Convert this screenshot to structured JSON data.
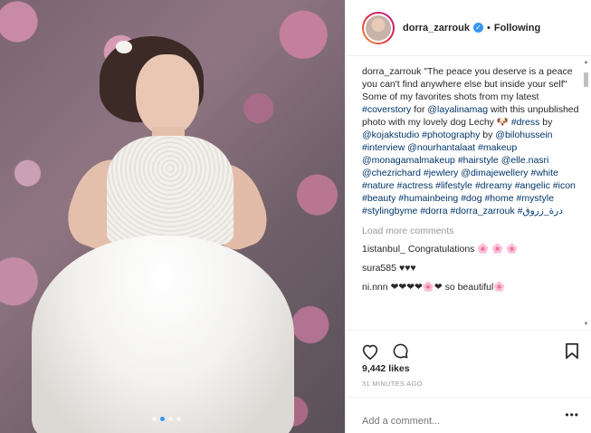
{
  "photo": {
    "carousel_total": 4,
    "carousel_active": 1
  },
  "header": {
    "username": "dorra_zarrouk",
    "separator": "•",
    "follow_status": "Following",
    "verified": true
  },
  "caption": {
    "username": "dorra_zarrouk",
    "parts": [
      {
        "t": "text",
        "v": " \"The peace you deserve is a peace you can't find anywhere else but inside your self\" Some of my favorites shots from my latest "
      },
      {
        "t": "tag",
        "v": "#coverstory"
      },
      {
        "t": "text",
        "v": " for "
      },
      {
        "t": "tag",
        "v": "@layalinamag"
      },
      {
        "t": "text",
        "v": " with this unpublished photo with my lovely dog Lechy 🐶 "
      },
      {
        "t": "tag",
        "v": "#dress"
      },
      {
        "t": "text",
        "v": " by "
      },
      {
        "t": "tag",
        "v": "@kojakstudio"
      },
      {
        "t": "text",
        "v": " "
      },
      {
        "t": "tag",
        "v": "#photography"
      },
      {
        "t": "text",
        "v": " by "
      },
      {
        "t": "tag",
        "v": "@bilohussein"
      },
      {
        "t": "text",
        "v": " "
      },
      {
        "t": "tag",
        "v": "#interview"
      },
      {
        "t": "text",
        "v": " "
      },
      {
        "t": "tag",
        "v": "@nourhantalaat"
      },
      {
        "t": "text",
        "v": " "
      },
      {
        "t": "tag",
        "v": "#makeup"
      },
      {
        "t": "text",
        "v": " "
      },
      {
        "t": "tag",
        "v": "@monagamalmakeup"
      },
      {
        "t": "text",
        "v": " "
      },
      {
        "t": "tag",
        "v": "#hairstyle"
      },
      {
        "t": "text",
        "v": " "
      },
      {
        "t": "tag",
        "v": "@elle.nasri"
      },
      {
        "t": "text",
        "v": " "
      },
      {
        "t": "tag",
        "v": "@chezrichard"
      },
      {
        "t": "text",
        "v": " "
      },
      {
        "t": "tag",
        "v": "#jewlery"
      },
      {
        "t": "text",
        "v": " "
      },
      {
        "t": "tag",
        "v": "@dimajewellery"
      },
      {
        "t": "text",
        "v": " "
      },
      {
        "t": "tag",
        "v": "#white"
      },
      {
        "t": "text",
        "v": " "
      },
      {
        "t": "tag",
        "v": "#nature"
      },
      {
        "t": "text",
        "v": " "
      },
      {
        "t": "tag",
        "v": "#actress"
      },
      {
        "t": "text",
        "v": " "
      },
      {
        "t": "tag",
        "v": "#lifestyle"
      },
      {
        "t": "text",
        "v": " "
      },
      {
        "t": "tag",
        "v": "#dreamy"
      },
      {
        "t": "text",
        "v": " "
      },
      {
        "t": "tag",
        "v": "#angelic"
      },
      {
        "t": "text",
        "v": " "
      },
      {
        "t": "tag",
        "v": "#icon"
      },
      {
        "t": "text",
        "v": " "
      },
      {
        "t": "tag",
        "v": "#beauty"
      },
      {
        "t": "text",
        "v": " "
      },
      {
        "t": "tag",
        "v": "#humainbeing"
      },
      {
        "t": "text",
        "v": " "
      },
      {
        "t": "tag",
        "v": "#dog"
      },
      {
        "t": "text",
        "v": " "
      },
      {
        "t": "tag",
        "v": "#home"
      },
      {
        "t": "text",
        "v": " "
      },
      {
        "t": "tag",
        "v": "#mystyle"
      },
      {
        "t": "text",
        "v": " "
      },
      {
        "t": "tag",
        "v": "#stylingbyme"
      },
      {
        "t": "text",
        "v": " "
      },
      {
        "t": "tag",
        "v": "#dorra"
      },
      {
        "t": "text",
        "v": " "
      },
      {
        "t": "tag",
        "v": "#dorra_zarrouk"
      },
      {
        "t": "text",
        "v": " "
      },
      {
        "t": "tag",
        "v": "#درة_زروق"
      }
    ]
  },
  "load_more": "Load more comments",
  "comments": [
    {
      "user": "1istanbul_",
      "text": "Congratulations 🌸 🌸 🌸"
    },
    {
      "user": "sura585",
      "text": "♥♥♥"
    },
    {
      "user": "ni.nnn",
      "text": "❤❤❤❤🌸❤ so beautiful🌸"
    }
  ],
  "likes": "9,442 likes",
  "timestamp": "31 MINUTES AGO",
  "add_comment": {
    "placeholder": "Add a comment...",
    "more_icon": "•••"
  },
  "icons": {
    "like": "heart-outline-icon",
    "comment": "speech-bubble-icon",
    "save": "bookmark-icon",
    "verified": "verified-badge-icon"
  },
  "colors": {
    "link": "#003569",
    "verified": "#3897f0",
    "meta": "#999999",
    "text": "#262626"
  }
}
